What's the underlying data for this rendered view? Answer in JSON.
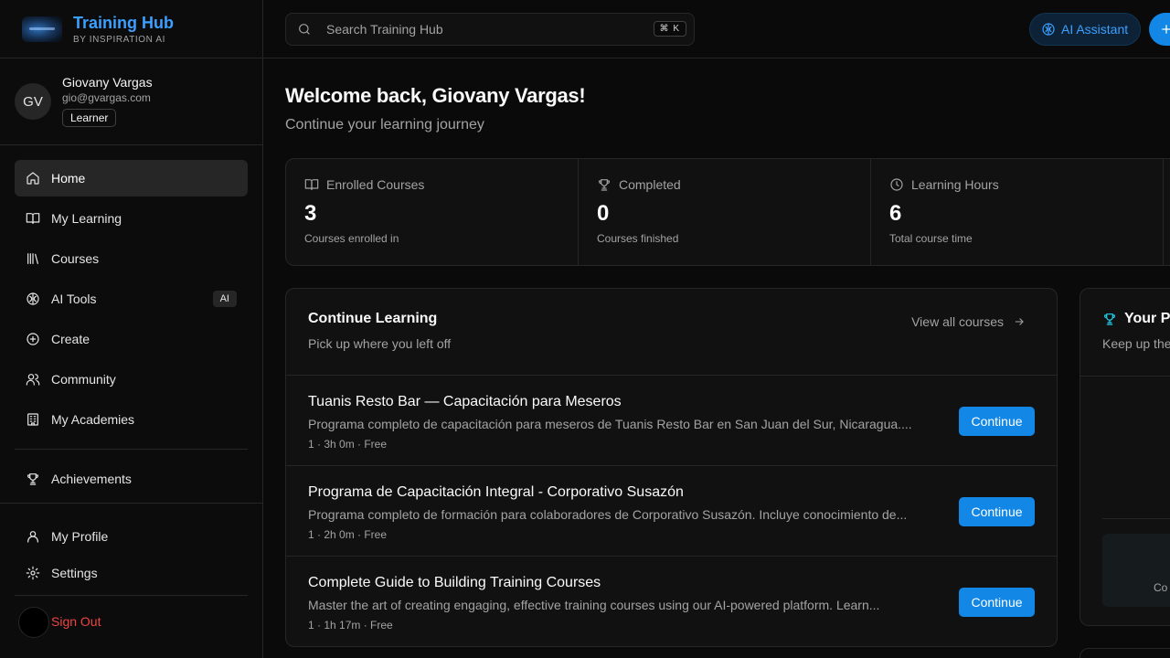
{
  "brand": {
    "title": "Training Hub",
    "subtitle": "BY INSPIRATION AI"
  },
  "user": {
    "initials": "GV",
    "name": "Giovany Vargas",
    "email": "gio@gvargas.com",
    "role": "Learner"
  },
  "nav": {
    "items": [
      {
        "label": "Home",
        "icon": "home-icon",
        "active": true
      },
      {
        "label": "My Learning",
        "icon": "book-open-icon"
      },
      {
        "label": "Courses",
        "icon": "library-icon"
      },
      {
        "label": "AI Tools",
        "icon": "brain-icon",
        "badge": "AI"
      },
      {
        "label": "Create",
        "icon": "plus-circle-icon"
      },
      {
        "label": "Community",
        "icon": "users-icon"
      },
      {
        "label": "My Academies",
        "icon": "building-icon"
      }
    ],
    "achievements": "Achievements",
    "profile": "My Profile",
    "settings": "Settings",
    "signout": "Sign Out"
  },
  "topbar": {
    "search_placeholder": "Search Training Hub",
    "shortcut": "⌘ K",
    "ai_assistant": "AI Assistant"
  },
  "welcome": {
    "title": "Welcome back, Giovany Vargas!",
    "subtitle": "Continue your learning journey"
  },
  "stats": [
    {
      "label": "Enrolled Courses",
      "value": "3",
      "desc": "Courses enrolled in",
      "icon": "book-open-icon"
    },
    {
      "label": "Completed",
      "value": "0",
      "desc": "Courses finished",
      "icon": "trophy-icon"
    },
    {
      "label": "Learning Hours",
      "value": "6",
      "desc": "Total course time",
      "icon": "clock-icon"
    }
  ],
  "continue_learning": {
    "title": "Continue Learning",
    "subtitle": "Pick up where you left off",
    "view_all": "View all courses",
    "button_label": "Continue",
    "courses": [
      {
        "title": "Tuanis Resto Bar — Capacitación para Meseros",
        "desc": "Programa completo de capacitación para meseros de Tuanis Resto Bar en San Juan del Sur, Nicaragua....",
        "meta": "1 · 3h 0m · Free"
      },
      {
        "title": "Programa de Capacitación Integral - Corporativo Susazón",
        "desc": "Programa completo de formación para colaboradores de Corporativo Susazón. Incluye conocimiento de...",
        "meta": "1 · 2h 0m · Free"
      },
      {
        "title": "Complete Guide to Building Training Courses",
        "desc": "Master the art of creating engaging, effective training courses using our AI-powered platform. Learn...",
        "meta": "1 · 1h 17m · Free"
      }
    ]
  },
  "progress_card": {
    "title": "Your P",
    "subtitle": "Keep up the",
    "box_text": "Co"
  },
  "colors": {
    "accent": "#1287e6",
    "brand": "#3ba0ff",
    "danger": "#ef4444",
    "trophy": "#22d3ee"
  }
}
